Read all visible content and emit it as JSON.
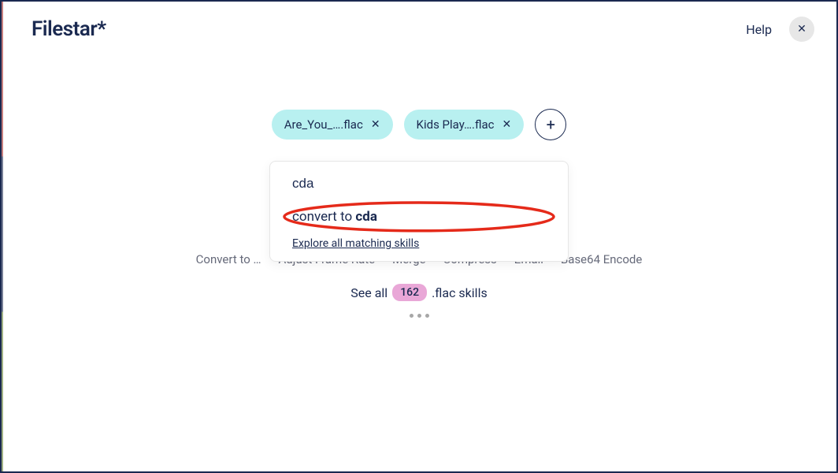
{
  "header": {
    "brand": "Filestar",
    "brand_suffix": "*",
    "help_label": "Help",
    "close_glyph": "✕"
  },
  "files": {
    "chips": [
      {
        "label": "Are_You_….flac",
        "remove_glyph": "✕"
      },
      {
        "label": "Kids Play….flac",
        "remove_glyph": "✕"
      }
    ],
    "add_glyph": "+"
  },
  "dropdown": {
    "input_value": "cda",
    "suggestion_prefix": "convert to ",
    "suggestion_bold": "cda",
    "explore_label": "Explore all matching skills"
  },
  "skill_row": {
    "items": [
      "Convert to …",
      "Adjust Frame Rate",
      "Merge",
      "Compress",
      "Email",
      "Base64 Encode"
    ]
  },
  "see_all": {
    "prefix": "See all",
    "count": "162",
    "suffix": ".flac skills"
  },
  "annotation": {
    "ellipse_color": "#e52a1a"
  }
}
